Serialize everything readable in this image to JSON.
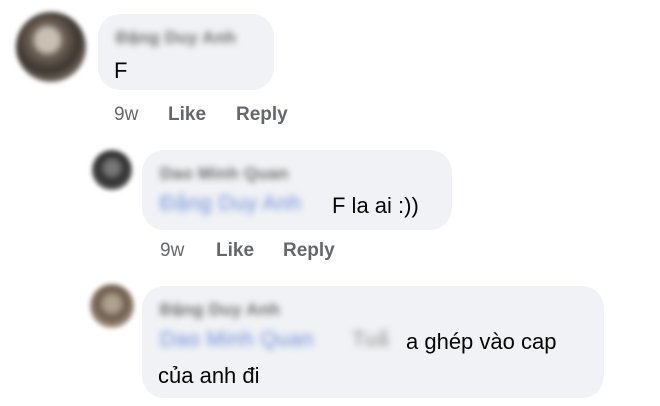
{
  "comments": [
    {
      "author": "Đặng Duy Anh",
      "text": "F",
      "time": "9w",
      "like_label": "Like",
      "reply_label": "Reply"
    },
    {
      "author": "Dao Minh Quan",
      "mention": "Đặng Duy Anh",
      "text": "F la ai :))",
      "time": "9w",
      "like_label": "Like",
      "reply_label": "Reply"
    },
    {
      "author": "Đặng Duy Anh",
      "mention": "Dao Minh Quan",
      "mention_extra": "Tuấ",
      "text_line1": "a ghép vào cap",
      "text_line2": "của anh đi"
    }
  ]
}
